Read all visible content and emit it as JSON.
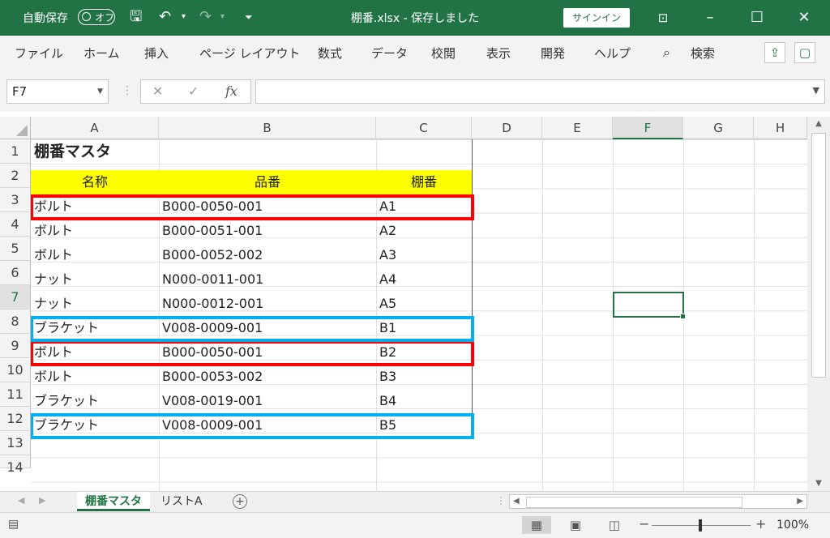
{
  "titlebar": {
    "autosave_label": "自動保存",
    "autosave_state": "オフ",
    "filename": "棚番.xlsx",
    "save_status": "保存しました",
    "signin_label": "サインイン"
  },
  "ribbon": {
    "tabs": [
      "ファイル",
      "ホーム",
      "挿入",
      "ページ レイアウト",
      "数式",
      "データ",
      "校閲",
      "表示",
      "開発",
      "ヘルプ"
    ],
    "search_label": "検索"
  },
  "formula_bar": {
    "name_box": "F7",
    "fx_label": "fx",
    "formula": ""
  },
  "columns": [
    "A",
    "B",
    "C",
    "D",
    "E",
    "F",
    "G",
    "H"
  ],
  "selected_column": "F",
  "rows": [
    "1",
    "2",
    "3",
    "4",
    "5",
    "6",
    "7",
    "8",
    "9",
    "10",
    "11",
    "12",
    "13",
    "14"
  ],
  "selected_row": "7",
  "sheet": {
    "title": "棚番マスタ",
    "headers": [
      "名称",
      "品番",
      "棚番"
    ],
    "data": [
      [
        "ボルト",
        "B000-0050-001",
        "A1"
      ],
      [
        "ボルト",
        "B000-0051-001",
        "A2"
      ],
      [
        "ボルト",
        "B000-0052-002",
        "A3"
      ],
      [
        "ナット",
        "N000-0011-001",
        "A4"
      ],
      [
        "ナット",
        "N000-0012-001",
        "A5"
      ],
      [
        "ブラケット",
        "V008-0009-001",
        "B1"
      ],
      [
        "ボルト",
        "B000-0050-001",
        "B2"
      ],
      [
        "ボルト",
        "B000-0053-002",
        "B3"
      ],
      [
        "ブラケット",
        "V008-0019-001",
        "B4"
      ],
      [
        "ブラケット",
        "V008-0009-001",
        "B5"
      ]
    ],
    "highlight_colors": {
      "red": "#ff0000",
      "blue": "#00b0f0",
      "header_fill": "#ffff00"
    }
  },
  "sheet_tabs": [
    "棚番マスタ",
    "リストA"
  ],
  "active_sheet": "棚番マスタ",
  "status": {
    "zoom": "100%"
  },
  "theme": {
    "accent": "#217346"
  }
}
